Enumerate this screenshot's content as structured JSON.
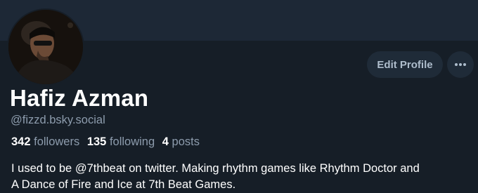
{
  "profile": {
    "display_name": "Hafiz Azman",
    "handle": "@fizzd.bsky.social",
    "avatar_icon": "avatar-photo",
    "stats": {
      "followers_count": "342",
      "followers_label": "followers",
      "following_count": "135",
      "following_label": "following",
      "posts_count": "4",
      "posts_label": "posts"
    },
    "bio_line1": "I used to be @7thbeat on twitter. Making rhythm games like Rhythm Doctor and",
    "bio_line2": "A Dance of Fire and Ice at 7th Beat Games."
  },
  "actions": {
    "edit_label": "Edit Profile",
    "more_icon": "ellipsis-icon"
  },
  "colors": {
    "background": "#161e27",
    "banner": "#1d2836",
    "button_bg": "#1f2b38",
    "muted_text": "#8d9cad",
    "primary_text": "#ffffff"
  }
}
